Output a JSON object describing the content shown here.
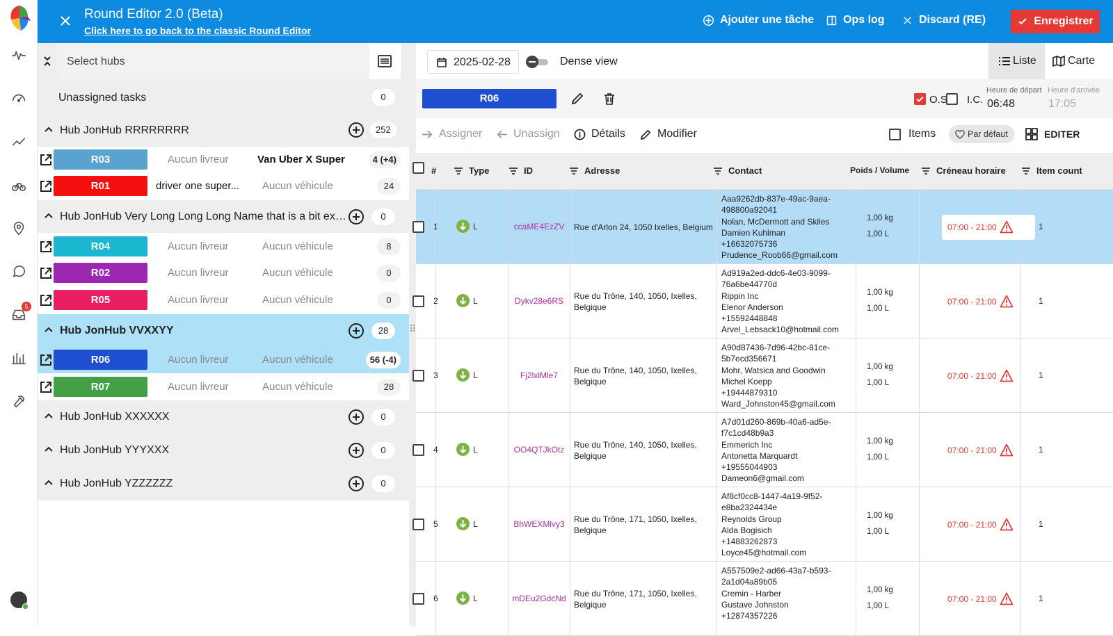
{
  "header": {
    "title": "Round Editor 2.0 (Beta)",
    "subtitle_link": "Click here to go back to the classic Round Editor",
    "add_task": "Ajouter une tâche",
    "ops_log": "Ops log",
    "discard": "Discard (RE)",
    "save": "Enregistrer"
  },
  "rail": {
    "inbox_badge": "5"
  },
  "left": {
    "select_hubs_placeholder": "Select hubs",
    "unassigned_label": "Unassigned tasks",
    "unassigned_count": "0",
    "hubs": [
      {
        "name": "Hub JonHub RRRRRRRR",
        "count": "252",
        "rounds": [
          {
            "code": "R03",
            "color": "#5aa2cf",
            "driver": "Aucun livreur",
            "vehicle": "Van Uber X Super",
            "count": "4 (+4)"
          },
          {
            "code": "R01",
            "color": "#f50f0f",
            "driver": "driver one super...",
            "vehicle": "Aucun véhicule",
            "count": "24"
          }
        ]
      },
      {
        "name": "Hub JonHub Very Long Long Long Name that is a bit excessive",
        "count": "0",
        "rounds": [
          {
            "code": "R04",
            "color": "#1bb6d0",
            "driver": "Aucun livreur",
            "vehicle": "Aucun véhicule",
            "count": "8"
          },
          {
            "code": "R02",
            "color": "#9c27b0",
            "driver": "Aucun livreur",
            "vehicle": "Aucun véhicule",
            "count": "0"
          },
          {
            "code": "R05",
            "color": "#e91e63",
            "driver": "Aucun livreur",
            "vehicle": "Aucun véhicule",
            "count": "0"
          }
        ]
      },
      {
        "name": "Hub JonHub VVXXYY",
        "count": "28",
        "rounds": [
          {
            "code": "R06",
            "color": "#1e4fd1",
            "driver": "Aucun livreur",
            "vehicle": "Aucun véhicule",
            "count": "56 (-4)"
          },
          {
            "code": "R07",
            "color": "#43a047",
            "driver": "Aucun livreur",
            "vehicle": "Aucun véhicule",
            "count": "28"
          }
        ]
      },
      {
        "name": "Hub JonHub XXXXXX",
        "count": "0",
        "rounds": []
      },
      {
        "name": "Hub JonHub YYYXXX",
        "count": "0",
        "rounds": []
      },
      {
        "name": "Hub JonHub YZZZZZZ",
        "count": "0",
        "rounds": []
      }
    ]
  },
  "right": {
    "date": "2025-02-28",
    "dense_view": "Dense view",
    "view_list": "Liste",
    "view_map": "Carte",
    "round_code": "R06",
    "os_label": "O.S.",
    "ic_label": "I.C.",
    "departure_label": "Heure de départ",
    "departure_time": "06:48",
    "arrival_label": "Heure d'arrivée",
    "arrival_time": "17:05",
    "assign": "Assigner",
    "unassign": "Unassign",
    "details": "Détails",
    "modify": "Modifier",
    "items": "Items",
    "default_chip": "Par défaut",
    "edit": "EDITER"
  },
  "table": {
    "columns": [
      "#",
      "Type",
      "ID",
      "Adresse",
      "Contact",
      "Poids / Volume",
      "Créneau horaire",
      "Item count"
    ],
    "rows": [
      {
        "num": "1",
        "type": "L",
        "id": "ccaME4EzZV",
        "address": [
          "Rue d'Arlon 24,  1050 Ixelles,  Belgium"
        ],
        "contact": [
          "Aaa9262db-837e-49ac-9aea-",
          "498800a92041",
          "Nolan, McDermott and Skiles",
          "Damien Kuhlman",
          "+16632075736",
          "Prudence_Roob66@gmail.com"
        ],
        "weight": "1,00 kg",
        "volume": "1,00 L",
        "slot": "07:00 - 21:00",
        "items": "1"
      },
      {
        "num": "2",
        "type": "L",
        "id": "Dykv28e6RS",
        "address": [
          "Rue du Trône, 140, 1050, Ixelles,",
          "Belgique"
        ],
        "contact": [
          "Ad919a2ed-ddc6-4e03-9099-",
          "76a6be44770d",
          "Rippin Inc",
          "Elenor Anderson",
          "+15592448848",
          "Arvel_Lebsack10@hotmail.com"
        ],
        "weight": "1,00 kg",
        "volume": "1,00 L",
        "slot": "07:00 - 21:00",
        "items": "1"
      },
      {
        "num": "3",
        "type": "L",
        "id": "Fj2lxlMle7",
        "address": [
          "Rue du Trône, 140, 1050, Ixelles,",
          "Belgique"
        ],
        "contact": [
          "A90d87436-7d96-42bc-81ce-",
          "5b7ecd356671",
          "Mohr, Watsica and Goodwin",
          "Michel Koepp",
          "+19444879310",
          "Ward_Johnston45@gmail.com"
        ],
        "weight": "1,00 kg",
        "volume": "1,00 L",
        "slot": "07:00 - 21:00",
        "items": "1"
      },
      {
        "num": "4",
        "type": "L",
        "id": "OO4QTJkOtz",
        "address": [
          "Rue du Trône, 140, 1050, Ixelles,",
          "Belgique"
        ],
        "contact": [
          "A7d01d260-869b-40a6-ad5e-",
          "f7c1cd48b9a3",
          "Emmerich Inc",
          "Antonetta Marquardt",
          "+19555044903",
          "Dameon6@gmail.com"
        ],
        "weight": "1,00 kg",
        "volume": "1,00 L",
        "slot": "07:00 - 21:00",
        "items": "1"
      },
      {
        "num": "5",
        "type": "L",
        "id": "BhWEXMlvy3",
        "address": [
          "Rue du Trône, 171, 1050, Ixelles,",
          "Belgique"
        ],
        "contact": [
          "Af8cf0cc8-1447-4a19-9f52-",
          "e8ba2324434e",
          "Reynolds Group",
          "Alda Bogisich",
          "+14883262873",
          "Loyce45@hotmail.com"
        ],
        "weight": "1,00 kg",
        "volume": "1,00 L",
        "slot": "07:00 - 21:00",
        "items": "1"
      },
      {
        "num": "6",
        "type": "L",
        "id": "mDEu2GdcNd",
        "address": [
          "Rue du Trône, 171, 1050, Ixelles,",
          "Belgique"
        ],
        "contact": [
          "A557509e2-ad66-43a7-b593-",
          "2a1d04a89b05",
          "Cremin - Harber",
          "Gustave Johnston",
          "+12874357226"
        ],
        "weight": "1,00 kg",
        "volume": "1,00 L",
        "slot": "07:00 - 21:00",
        "items": "1"
      }
    ]
  }
}
